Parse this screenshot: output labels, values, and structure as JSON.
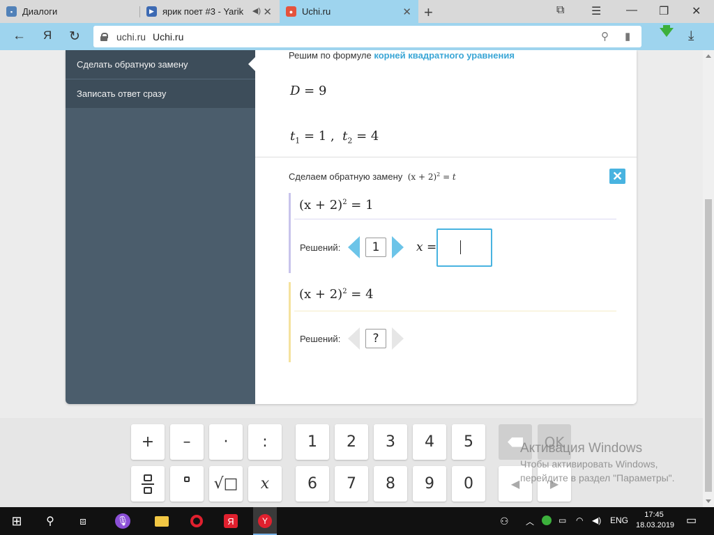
{
  "browser": {
    "tabs": [
      {
        "title": "Диалоги",
        "icon": "chat-bubble-icon",
        "color": "#5181b8"
      },
      {
        "title": "ярик поет #3 - Yarik",
        "icon": "video-play-icon",
        "color": "#3d6ab3"
      },
      {
        "title": "Uchi.ru",
        "icon": "uchi-logo-icon",
        "color": "#e4533d"
      }
    ],
    "address": {
      "host": "uchi.ru",
      "page_title": "Uchi.ru"
    },
    "nav_letter": "Я"
  },
  "sidebar": {
    "items": [
      {
        "label": "Сделать обратную замену"
      },
      {
        "label": "Записать ответ сразу"
      }
    ]
  },
  "content": {
    "intro": "Решим по формуле",
    "intro_link": "корней квадратного уравнения",
    "discriminant": {
      "var": "D",
      "eq": " = 9"
    },
    "roots": {
      "t1": "1",
      "t2": "4",
      "var": "t",
      "sub1": "1",
      "sub2": "2"
    },
    "substitution_text": "Сделаем обратную замену",
    "substitution_expr": {
      "left": "(x + 2)",
      "exp": "2",
      "right": " = t"
    },
    "close_symbol": "✕",
    "equations": [
      {
        "left": "(x + 2)",
        "exp": "2",
        "right": " = 1",
        "solutions_label": "Решений:",
        "count": "1",
        "x_label": "x =",
        "answer": ""
      },
      {
        "left": "(x + 2)",
        "exp": "2",
        "right": " = 4",
        "solutions_label": "Решений:",
        "count": "?"
      }
    ]
  },
  "keyboard": {
    "row1_ops": [
      "+",
      "–",
      "·",
      ":"
    ],
    "row2_ops": [
      "fraction",
      "degree",
      "√□",
      "x"
    ],
    "row1_digits": [
      "1",
      "2",
      "3",
      "4",
      "5"
    ],
    "row2_digits": [
      "6",
      "7",
      "8",
      "9",
      "0"
    ],
    "ok_label": "OK",
    "left_arrow": "◀",
    "right_arrow": "▶"
  },
  "watermark": {
    "line1": "Активация Windows",
    "line2": "Чтобы активировать Windows,",
    "line3": "перейдите в раздел \"Параметры\"."
  },
  "taskbar": {
    "lang": "ENG",
    "time": "17:45",
    "date": "18.03.2019"
  },
  "colors": {
    "accent": "#48b3e0",
    "sidebar": "#4b5d6c",
    "tab_active": "#9ed4ee"
  }
}
